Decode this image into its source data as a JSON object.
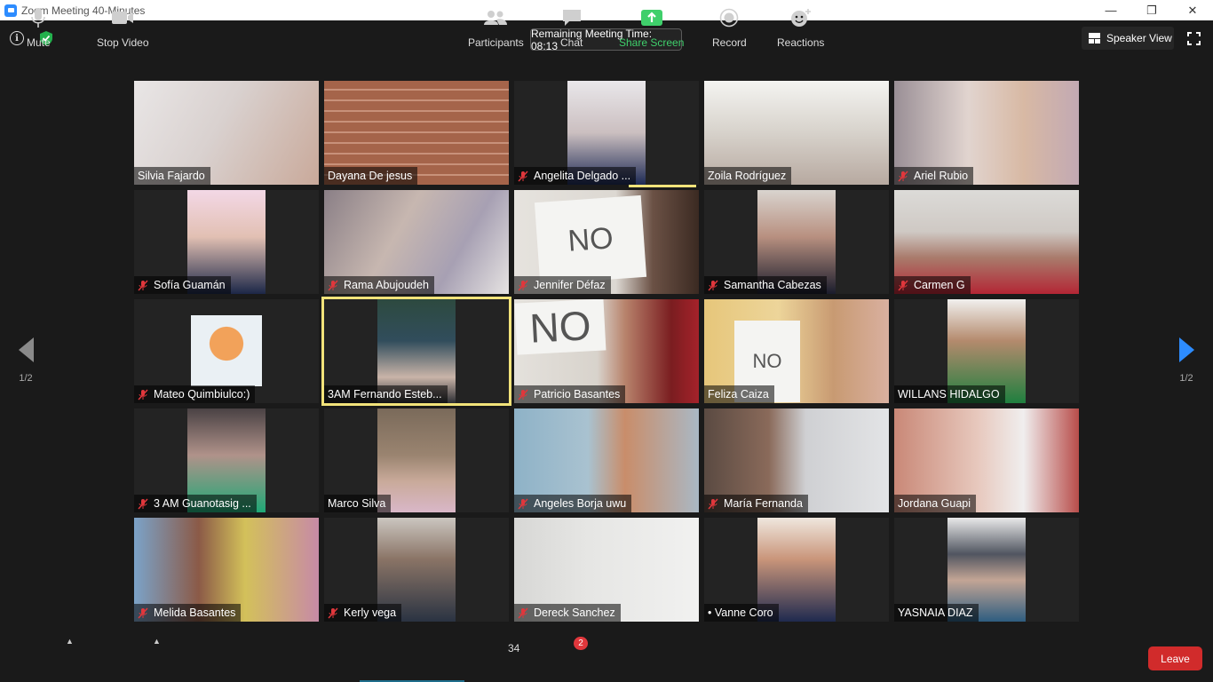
{
  "window": {
    "title": "Zoom Meeting 40-Minutes",
    "controls": [
      "—",
      "❐",
      "✕"
    ]
  },
  "top_bar": {
    "remaining_time": "Remaining Meeting Time: 08:13",
    "speaker_view": "Speaker View"
  },
  "pager": {
    "left": "1/2",
    "right": "1/2"
  },
  "participants": [
    {
      "name": "Silvia Fajardo",
      "muted": false
    },
    {
      "name": "Dayana De jesus",
      "muted": false
    },
    {
      "name": "Angelita Delgado ...",
      "muted": true
    },
    {
      "name": "Zoila Rodríguez",
      "muted": false
    },
    {
      "name": "Ariel Rubio",
      "muted": true
    },
    {
      "name": "Sofía Guamán",
      "muted": true
    },
    {
      "name": "Rama Abujoudeh",
      "muted": true
    },
    {
      "name": "Jennifer Défaz",
      "muted": true
    },
    {
      "name": "Samantha Cabezas",
      "muted": true
    },
    {
      "name": "Carmen G",
      "muted": true
    },
    {
      "name": "Mateo Quimbiulco:)",
      "muted": true
    },
    {
      "name": "3AM Fernando Esteb...",
      "muted": false
    },
    {
      "name": "Patricio Basantes",
      "muted": true
    },
    {
      "name": "Feliza Caiza",
      "muted": false
    },
    {
      "name": "WILLANS HIDALGO",
      "muted": false
    },
    {
      "name": "3 AM Guanotasig ...",
      "muted": true
    },
    {
      "name": "Marco Silva",
      "muted": false
    },
    {
      "name": "Angeles Borja uwu",
      "muted": true
    },
    {
      "name": "María Fernanda",
      "muted": true
    },
    {
      "name": "Jordana Guapi",
      "muted": false
    },
    {
      "name": "Melida Basantes",
      "muted": true
    },
    {
      "name": "Kerly vega",
      "muted": true
    },
    {
      "name": "Dereck Sanchez",
      "muted": true
    },
    {
      "name": "• Vanne Coro",
      "muted": false
    },
    {
      "name": "YASNAIA DIAZ",
      "muted": false
    }
  ],
  "signs": {
    "jennifer": "NO",
    "patricio": "NO",
    "feliza": "NO"
  },
  "toolbar": {
    "mute": "Mute",
    "stop_video": "Stop Video",
    "participants": "Participants",
    "participant_count": "34",
    "chat": "Chat",
    "chat_badge": "2",
    "share_screen": "Share Screen",
    "record": "Record",
    "reactions": "Reactions",
    "leave": "Leave"
  },
  "colors": {
    "accent": "#2d8cff",
    "share": "#3fcf6b",
    "leave": "#d12b2b",
    "active_speaker": "#f2e37a"
  }
}
